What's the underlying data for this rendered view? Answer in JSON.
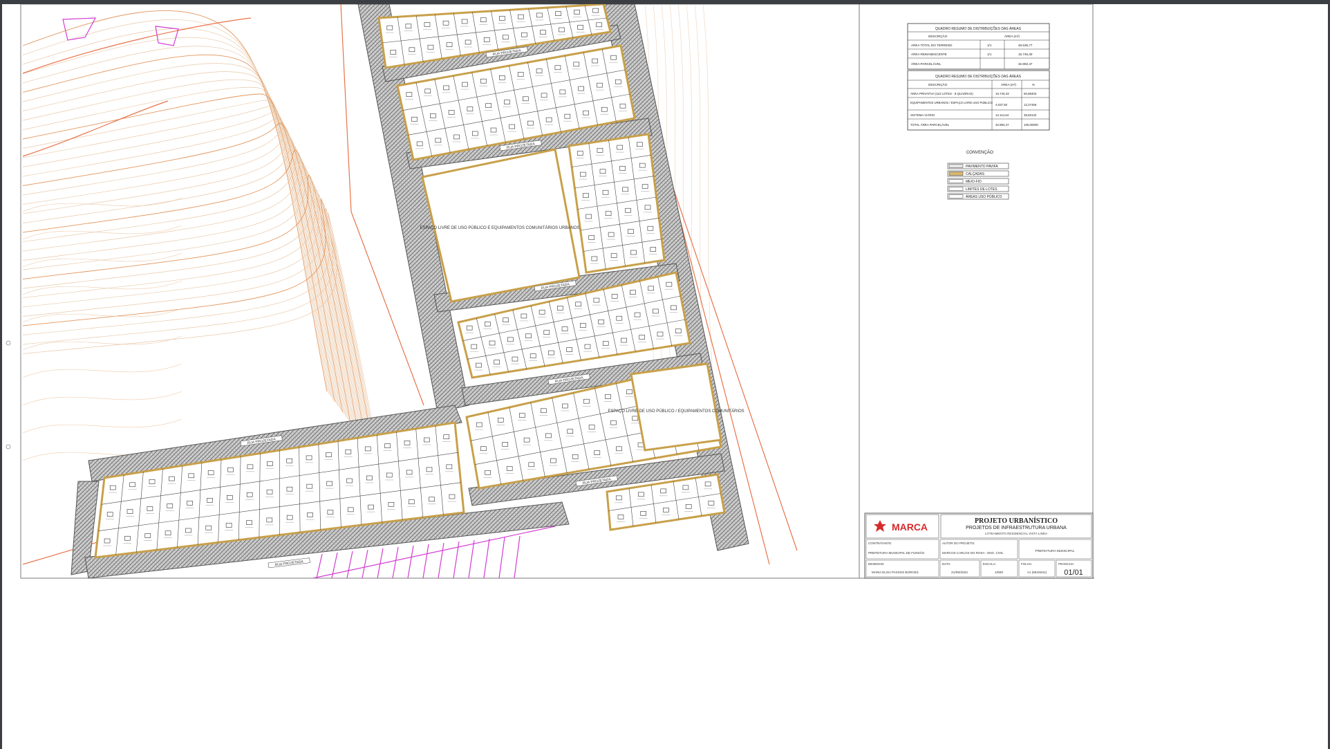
{
  "legend": {
    "title": "CONVENÇÃO:",
    "items": [
      {
        "label": "PAVIMENTO PAVIFA",
        "swatch": "#e6e6e6"
      },
      {
        "label": "CALÇADAS",
        "swatch": "#d9b86c"
      },
      {
        "label": "MEIO-FIO",
        "swatch": "#ffffff"
      },
      {
        "label": "LIMITES DE LOTES",
        "swatch": "#ffffff"
      },
      {
        "label": "ÁREAS USO PÚBLICO",
        "swatch": "#ffffff"
      }
    ]
  },
  "summary_table_1": {
    "title": "QUADRO RESUMO DE DISTRIBUIÇÕES DAS ÁREAS",
    "headers": [
      "DESCRIÇÃO",
      "ÁREA (m²)"
    ],
    "rows": [
      [
        "ÁREA TOTAL DO TERRENO",
        "1/1",
        "48.635,77"
      ],
      [
        "ÁREA REMANESCENTE",
        "1/1",
        "15.746,30"
      ],
      [
        "ÁREA PARCELÁVEL",
        "",
        "32.892,47"
      ]
    ]
  },
  "summary_table_2": {
    "title": "QUADRO RESUMO DE DISTRIBUIÇÕES DAS ÁREAS",
    "headers": [
      "DESCRIÇÃO",
      "ÁREA (m²)",
      "%"
    ],
    "rows": [
      [
        "ÁREA PRIVATIVA (110 LOTES - 8 QUADRAS)",
        "16.740,33",
        "50,89403"
      ],
      [
        "EQUIPAMENTOS URBANOS / ESPAÇO LIVRE USO PÚBLICO",
        "4.037,50",
        "12,27466"
      ],
      [
        "SISTEMA VIÁRIO",
        "12.114,64",
        "36,83132"
      ],
      [
        "TOTAL ÁREA PARCELÁVEL",
        "32.892,47",
        "100,00000"
      ]
    ]
  },
  "title_block": {
    "logo_text": "MARCA",
    "title": "PROJETO URBANÍSTICO",
    "subtitle": "PROJETOS DE INFRAESTRUTURA URBANA",
    "sub_small": "LOTEAMENTO RESIDENCIAL VISTA LINDA",
    "contractor_label": "CONTRATANTE:",
    "contractor": "PREFEITURA MUNICIPAL DE FUNDÃO",
    "author_label": "AUTOR DO PROJETO:",
    "author": "MARCOS CARLOS DO ROSA - ENG. CIVIL",
    "owner": "PREFEITURA MUNICIPAL",
    "drawn_label": "DESENHO:",
    "drawn": "MARIA ELISA PASSOS BORGES",
    "date_label": "DATA:",
    "date": "21/06/2022",
    "scale_label": "ESCALA:",
    "scale": "1/500",
    "format_label": "FOLHA:",
    "format": "A1 (594X841)",
    "sheet_label": "PRANCHA:",
    "sheet": "01/01"
  },
  "plan_labels": {
    "public_space_1": "ESPAÇO LIVRE DE USO PÚBLICO E EQUIPAMENTOS COMUNITÁRIOS URBANOS",
    "public_space_2": "ESPAÇO LIVRE DE USO PÚBLICO / EQUIPAMENTOS COMUNITÁRIOS",
    "street": "RUA PROJETADA"
  }
}
